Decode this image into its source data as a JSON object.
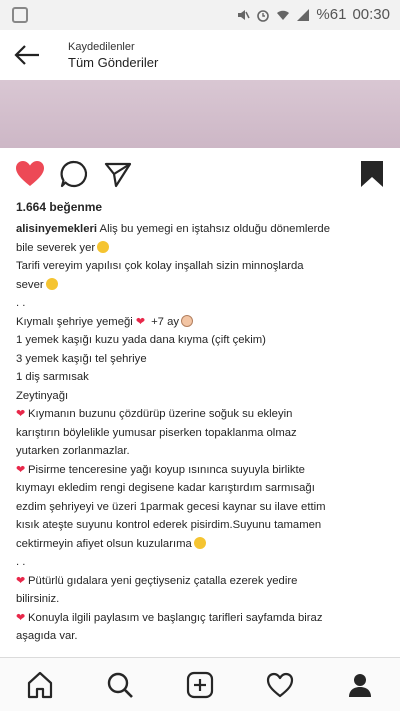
{
  "status_bar": {
    "battery": "%61",
    "time": "00:30"
  },
  "header": {
    "subtitle": "Kaydedilenler",
    "title": "Tüm Gönderiler"
  },
  "post": {
    "likes": "1.664 beğenme",
    "username": "alisinyemekleri",
    "lines": [
      " Aliş bu yemegi en iştahsız olduğu dönemlerde",
      "bile severek yer",
      "Tarifi vereyim yapılısı çok kolay inşallah  sizin minnoşlarda",
      "sever",
      ". .",
      "Kıymalı şehriye yemeği",
      "+7 ay",
      "1 yemek kaşığı kuzu yada dana kıyma (çift çekim)",
      "3 yemek kaşığı tel şehriye",
      "1 diş sarmısak",
      "Zeytinyağı",
      "Kıymanın buzunu çözdürüp üzerine soğuk su ekleyin",
      "karıştırın böylelikle yumusar piserken topaklanma olmaz",
      "yutarken zorlanmazlar.",
      "Pisirme tenceresine yağı koyup ısınınca suyuyla birlikte",
      "kıymayı ekledim rengi degisene kadar karıştırdım sarmısağı",
      "ezdim şehriyeyi ve üzeri 1parmak gecesi kaynar su ilave ettim",
      "kısık ateşte suyunu kontrol ederek pisirdim.Suyunu tamamen",
      "cektirmeyin afiyet olsun kuzularıma",
      ". .",
      "Pütürlü gıdalara yeni geçtiyseniz çatalla ezerek yedire",
      "bilirsiniz.",
      "Konuyla ilgili paylasım ve başlangıç tarifleri sayfamda biraz",
      "aşagıda var."
    ]
  },
  "colors": {
    "like_red": "#ed4956",
    "text": "#262626",
    "status_bg": "#f2f2f2"
  },
  "icons": {
    "back": "arrow-left-icon",
    "like": "heart-icon",
    "comment": "comment-icon",
    "share": "send-icon",
    "save": "bookmark-icon",
    "nav": [
      "home-icon",
      "search-icon",
      "add-post-icon",
      "activity-heart-icon",
      "profile-icon"
    ]
  }
}
